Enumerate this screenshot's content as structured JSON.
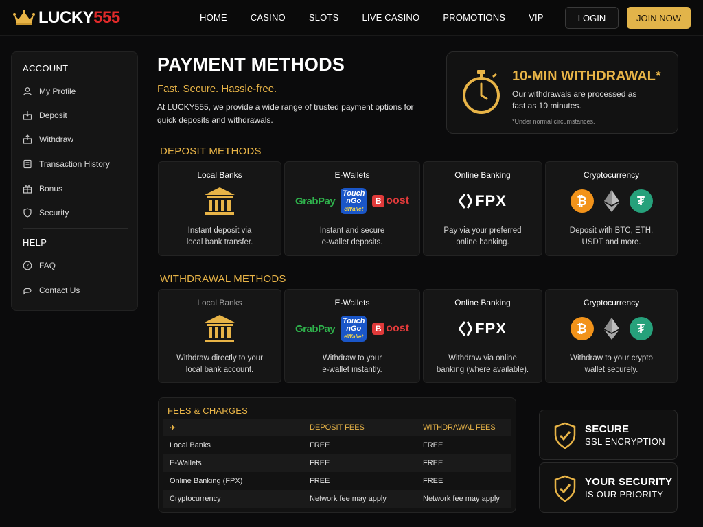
{
  "brand": {
    "name_white": "LUCKY",
    "name_red": "555"
  },
  "nav": [
    "HOME",
    "CASINO",
    "SLOTS",
    "LIVE CASINO",
    "PROMOTIONS",
    "VIP"
  ],
  "auth": {
    "login": "LOGIN",
    "join": "JOIN NOW"
  },
  "sidebar": {
    "account_heading": "ACCOUNT",
    "account_items": [
      "My Profile",
      "Deposit",
      "Withdraw",
      "Transaction History",
      "Bonus",
      "Security"
    ],
    "help_heading": "HELP",
    "help_items": [
      "FAQ",
      "Contact Us"
    ]
  },
  "page": {
    "title": "PAYMENT METHODS",
    "subtitle": "Fast. Secure. Hassle-free.",
    "intro": "At LUCKY555, we provide a wide range of trusted payment options for quick deposits and withdrawals."
  },
  "promo": {
    "title": "10-MIN WITHDRAWAL*",
    "text": "Our withdrawals are processed as fast as 10 minutes.",
    "note": "*Under normal circumstances."
  },
  "deposit": {
    "heading": "DEPOSIT METHODS",
    "cards": [
      {
        "title": "Local Banks",
        "desc1": "Instant deposit via",
        "desc2": "local bank transfer."
      },
      {
        "title": "E-Wallets",
        "desc1": "Instant and secure",
        "desc2": "e-wallet deposits."
      },
      {
        "title": "Online Banking",
        "desc1": "Pay via your preferred",
        "desc2": "online banking."
      },
      {
        "title": "Cryptocurrency",
        "desc1": "Deposit with BTC, ETH,",
        "desc2": "USDT and more."
      }
    ]
  },
  "withdrawal": {
    "heading": "WITHDRAWAL METHODS",
    "cards": [
      {
        "title": "Local Banks",
        "desc1": "Withdraw directly to your",
        "desc2": "local bank account."
      },
      {
        "title": "E-Wallets",
        "desc1": "Withdraw to your",
        "desc2": "e-wallet instantly."
      },
      {
        "title": "Online Banking",
        "desc1": "Withdraw via online",
        "desc2": "banking (where available)."
      },
      {
        "title": "Cryptocurrency",
        "desc1": "Withdraw to your crypto",
        "desc2": "wallet securely."
      }
    ]
  },
  "logos": {
    "grabpay": "GrabPay",
    "tng_line1": "Touch",
    "tng_line2": "nGo",
    "tng_line3": "eWallet",
    "boost": "oost",
    "fpx": "FPX"
  },
  "fees": {
    "title": "FEES & CHARGES",
    "headers": [
      "DEPOSIT FEES",
      "WITHDRAWAL FEES"
    ],
    "rows": [
      {
        "method": "Local Banks",
        "deposit": "FREE",
        "withdrawal": "FREE"
      },
      {
        "method": "E-Wallets",
        "deposit": "FREE",
        "withdrawal": "FREE"
      },
      {
        "method": "Online Banking (FPX)",
        "deposit": "FREE",
        "withdrawal": "FREE"
      },
      {
        "method": "Cryptocurrency",
        "deposit": "Network fee may apply",
        "withdrawal": "Network fee may apply"
      }
    ]
  },
  "badges": [
    {
      "line1": "SECURE",
      "line2": "SSL ENCRYPTION"
    },
    {
      "line1": "YOUR SECURITY",
      "line2": "IS OUR PRIORITY"
    }
  ],
  "colors": {
    "accent": "#e8b447",
    "brand_red": "#e02a2a",
    "background": "#0b0b0c"
  }
}
